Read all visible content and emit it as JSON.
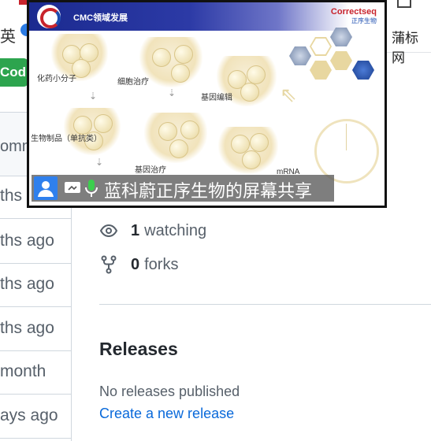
{
  "browser": {
    "tab_fragment": "英",
    "bookmark_label": "蒲标网"
  },
  "file_list": {
    "code_button_label": "Cod",
    "commits_label": "omm",
    "rows": [
      "ths ag",
      "ths ago",
      "ths ago",
      "ths ago",
      "month",
      "ays ago"
    ]
  },
  "repo_meta": {
    "watching_count": "1",
    "watching_label": "watching",
    "forks_count": "0",
    "forks_label": "forks"
  },
  "releases": {
    "title": "Releases",
    "none_text": "No releases published",
    "create_link": "Create a new release"
  },
  "screen_share": {
    "caption": "蓝科蔚正序生物的屏幕共享",
    "slide": {
      "banner_title": "CMC领域发展",
      "brand": "Correctseq",
      "brand_sub": "正序生物",
      "labels": [
        "化药小分子",
        "细胞治疗",
        "基因编辑",
        "生物制品（单抗类）",
        "基因治疗",
        "mRNA"
      ]
    }
  }
}
